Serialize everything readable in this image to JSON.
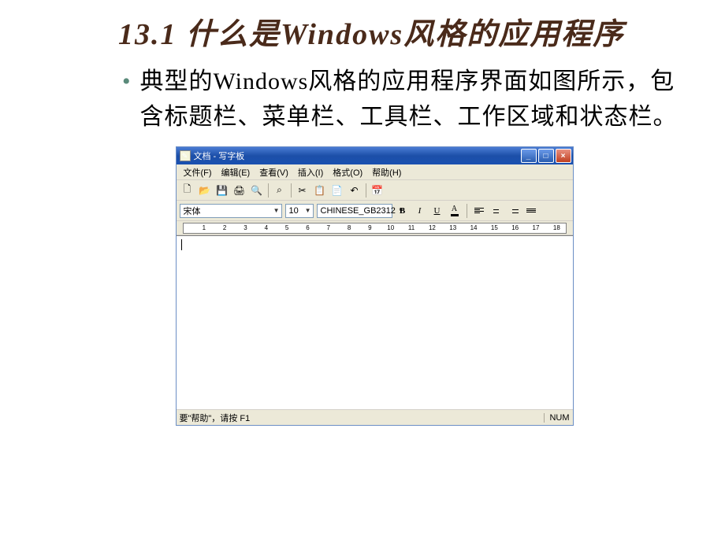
{
  "slide": {
    "title": "13.1  什么是Windows风格的应用程序",
    "bullet": "典型的Windows风格的应用程序界面如图所示，包含标题栏、菜单栏、工具栏、工作区域和状态栏。"
  },
  "wordpad": {
    "title": "文档 - 写字板",
    "menu": [
      "文件(F)",
      "编辑(E)",
      "查看(V)",
      "插入(I)",
      "格式(O)",
      "帮助(H)"
    ],
    "font": "宋体",
    "fontsize": "10",
    "charset": "CHINESE_GB2312",
    "fmt": {
      "b": "B",
      "i": "I",
      "u": "U"
    },
    "ruler_marks": [
      "1",
      "2",
      "3",
      "4",
      "5",
      "6",
      "7",
      "8",
      "9",
      "10",
      "11",
      "12",
      "13",
      "14",
      "15",
      "16",
      "17",
      "18"
    ],
    "status_left": "要\"帮助\"，请按 F1",
    "status_right": "NUM"
  }
}
